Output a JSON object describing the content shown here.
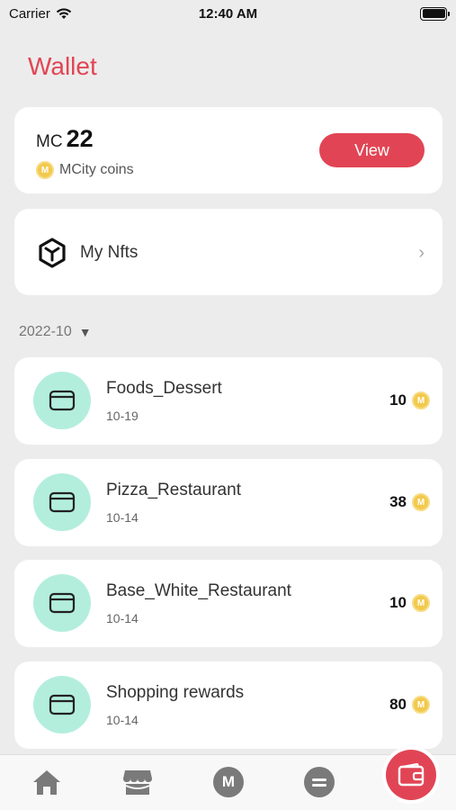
{
  "status_bar": {
    "carrier": "Carrier",
    "time": "12:40 AM"
  },
  "page": {
    "title": "Wallet"
  },
  "balance": {
    "currency_prefix": "MC",
    "amount": "22",
    "coin_label": "MCity coins",
    "view_label": "View"
  },
  "nfts": {
    "label": "My Nfts"
  },
  "filter": {
    "month": "2022-10"
  },
  "transactions": [
    {
      "title": "Foods_Dessert",
      "date": "10-19",
      "amount": "10"
    },
    {
      "title": "Pizza_Restaurant",
      "date": "10-14",
      "amount": "38"
    },
    {
      "title": "Base_White_Restaurant",
      "date": "10-14",
      "amount": "10"
    },
    {
      "title": "Shopping rewards",
      "date": "10-14",
      "amount": "80"
    }
  ],
  "coin_glyph": "M",
  "tab_bar": {
    "tabs": [
      {
        "icon": "home-icon"
      },
      {
        "icon": "store-icon"
      },
      {
        "icon": "mcity-icon",
        "glyph": "M"
      },
      {
        "icon": "menu-icon"
      },
      {
        "icon": "wallet-icon",
        "active": true
      }
    ]
  },
  "colors": {
    "accent": "#e14555",
    "mint": "#b3eedd",
    "coin": "#f2c94c"
  }
}
